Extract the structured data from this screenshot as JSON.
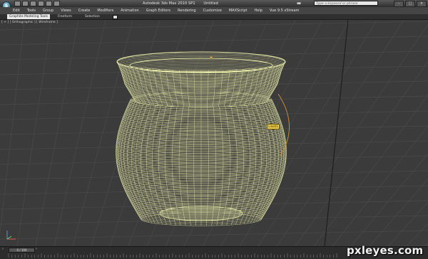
{
  "title_bar": {
    "app_title": "Autodesk 3ds Max  2010 SP1",
    "document": "Untitled",
    "search_placeholder": "Type a keyword or phrase",
    "logo_icon": "3ds-max-logo-icon"
  },
  "menu": {
    "items": [
      "Edit",
      "Tools",
      "Group",
      "Views",
      "Create",
      "Modifiers",
      "Animation",
      "Graph Editors",
      "Rendering",
      "Customize",
      "MAXScript",
      "Help",
      "Vue 9.5 xStream"
    ]
  },
  "ribbon": {
    "tabs": [
      "Graphite Modeling Tools",
      "Freeform",
      "Selection"
    ]
  },
  "viewport": {
    "label": "[ + ] [ Orthographic ] [ Wireframe ]",
    "pivot_label": "Line01"
  },
  "timeline": {
    "frame_display": "0 / 100",
    "prev_icon": "chevron-left-icon",
    "next_icon": "chevron-right-icon"
  },
  "watermark": "pxleyes.com",
  "colors": {
    "wireframe": "#e9eba8",
    "viewport_bg": "#3b3b3b",
    "grid_line": "#4a4a4a",
    "grid_axis": "#1e1e1e"
  }
}
